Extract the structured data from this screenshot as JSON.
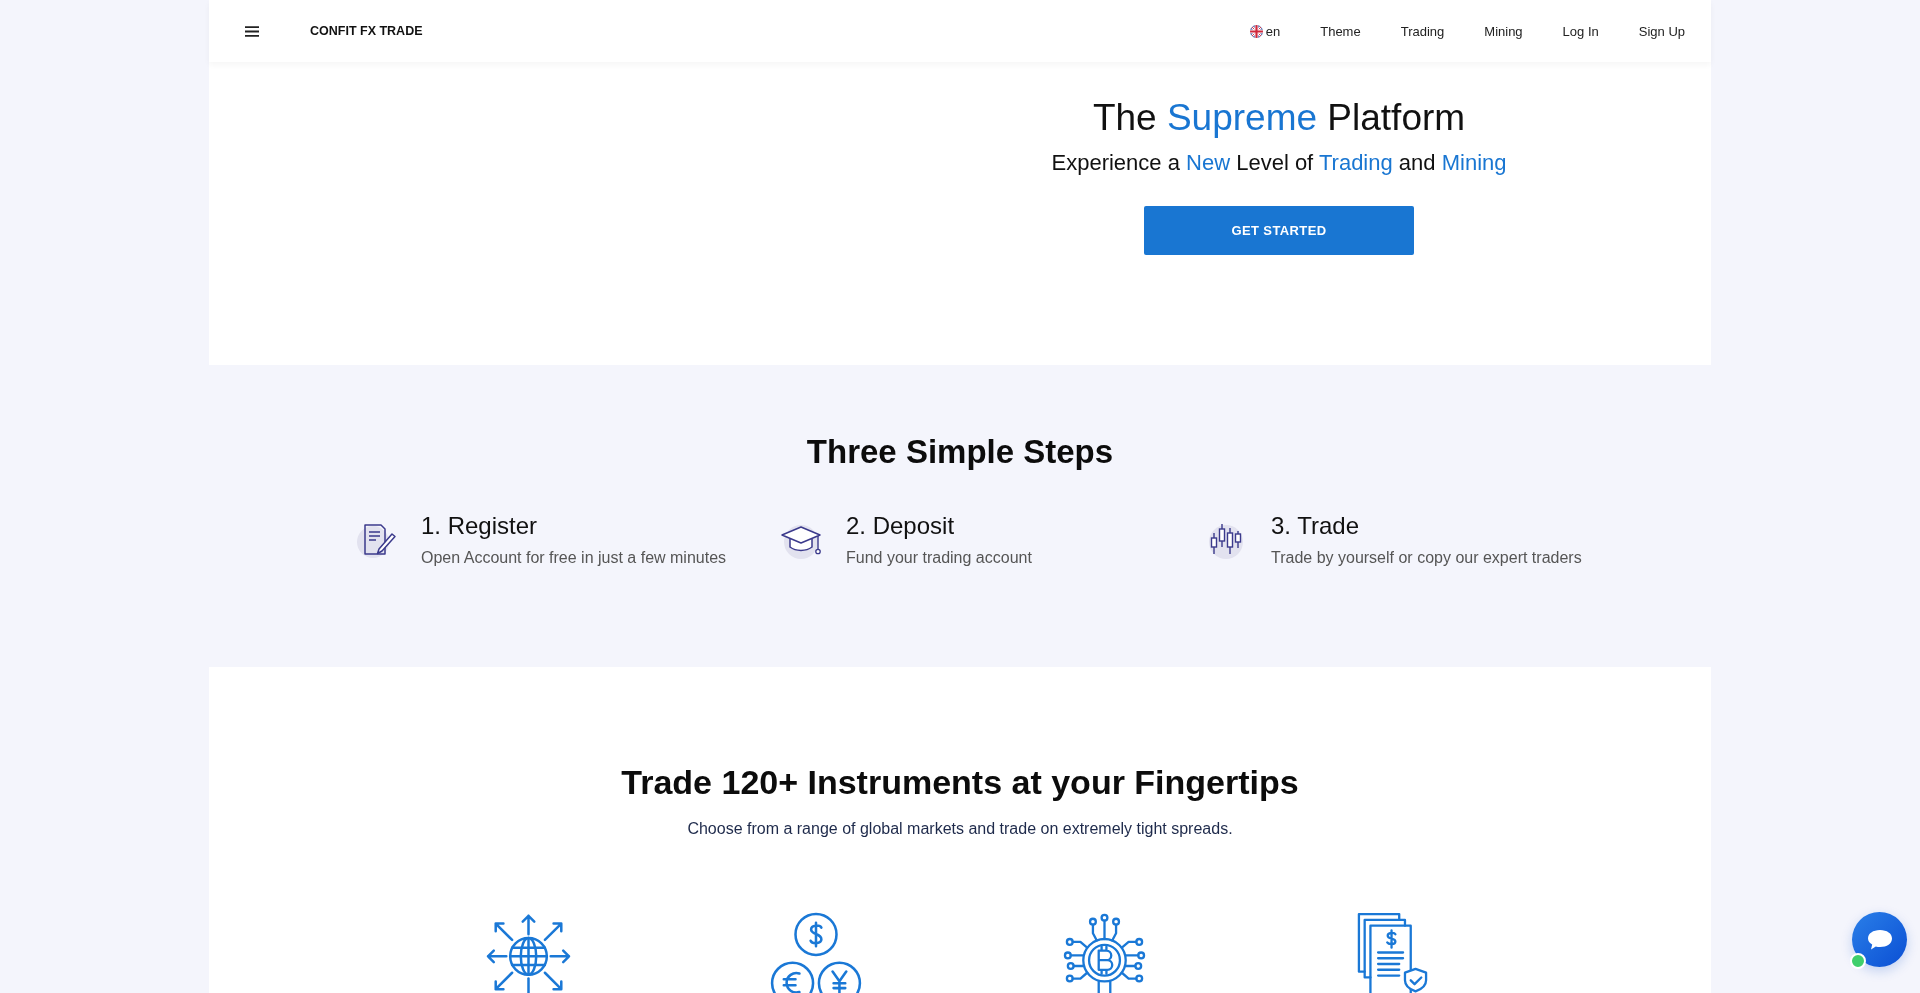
{
  "header": {
    "brand": "CONFIT FX TRADE",
    "language": "en",
    "nav_links": [
      "Theme",
      "Trading",
      "Mining",
      "Log In",
      "Sign Up"
    ]
  },
  "hero": {
    "title": [
      {
        "text": "The",
        "highlight": false
      },
      {
        "text": "Supreme",
        "highlight": true
      },
      {
        "text": "Platform",
        "highlight": false
      }
    ],
    "subtitle": [
      {
        "text": "Experience a",
        "highlight": false
      },
      {
        "text": "New",
        "highlight": true
      },
      {
        "text": "Level of",
        "highlight": false
      },
      {
        "text": "Trading",
        "highlight": true
      },
      {
        "text": "and",
        "highlight": false
      },
      {
        "text": "Mining",
        "highlight": true
      }
    ],
    "button": "GET STARTED"
  },
  "steps_section": {
    "title": "Three Simple Steps",
    "steps": [
      {
        "title": "1. Register",
        "description": "Open Account for free in just a few minutes"
      },
      {
        "title": "2. Deposit",
        "description": "Fund your trading account"
      },
      {
        "title": "3. Trade",
        "description": "Trade by yourself or copy our expert traders"
      }
    ]
  },
  "instruments_section": {
    "title": "Trade 120+ Instruments at your Fingertips",
    "subtitle": "Choose from a range of global markets and trade on extremely tight spreads."
  },
  "chat_widget": {
    "online": true
  }
}
